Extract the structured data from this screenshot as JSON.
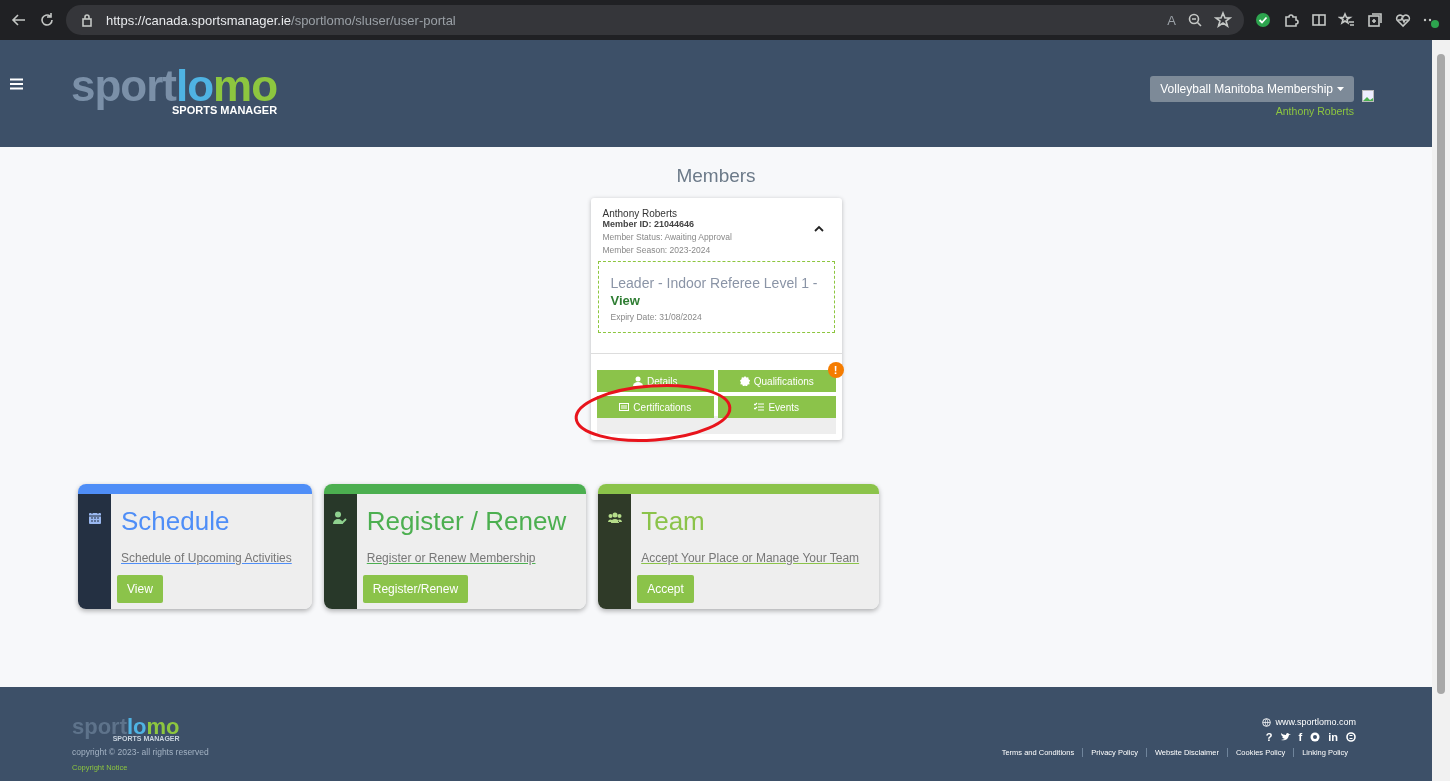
{
  "browser": {
    "url_host": "https://canada.sportsmanager.ie",
    "url_path": "/sportlomo/sluser/user-portal",
    "read_aloud": "A"
  },
  "header": {
    "logo": {
      "part1": "sport",
      "part2": "lomo",
      "tagline": "SPORTS MANAGER"
    },
    "org_dropdown": "Volleyball Manitoba Membership",
    "user_name": "Anthony Roberts"
  },
  "page_title": "Members",
  "member_card": {
    "name": "Anthony Roberts",
    "member_id": "Member ID: 21044646",
    "status": "Member Status: Awaiting Approval",
    "season": "Member Season: 2023-2024",
    "expanded": true,
    "qualification": {
      "title": "Leader - Indoor Referee Level 1  -",
      "link": "View",
      "expiry": "Expiry Date: 31/08/2024"
    },
    "buttons": [
      {
        "kind": "person",
        "label": "Details"
      },
      {
        "kind": "badge",
        "label": "Qualifications",
        "badge": "!"
      },
      {
        "kind": "card",
        "label": "Certifications"
      },
      {
        "kind": "list",
        "label": "Events"
      }
    ]
  },
  "annotation": {
    "kind": "ellipse",
    "color": "#e8141c"
  },
  "tiles": [
    {
      "kind": "calendar",
      "title": "Schedule",
      "link": "Schedule of Upcoming Activities",
      "button": "View",
      "color": "#4f8ef7"
    },
    {
      "kind": "person",
      "title": "Register / Renew",
      "link": "Register or Renew Membership",
      "button": "Register/Renew",
      "color": "#4caf50"
    },
    {
      "kind": "group",
      "title": "Team",
      "link": "Accept Your Place or Manage Your Team",
      "button": "Accept",
      "color": "#8bc34a"
    }
  ],
  "footer": {
    "logo": {
      "part1": "sport",
      "part2": "lomo",
      "tagline": "SPORTS MANAGER"
    },
    "copyright": "copyright © 2023- all rights reserved",
    "copyright_notice": "Copyright Notice",
    "website": "www.sportlomo.com",
    "social": [
      {
        "kind": "text",
        "label": "?"
      },
      {
        "kind": "twitter"
      },
      {
        "kind": "text",
        "label": "f"
      },
      {
        "kind": "circle"
      },
      {
        "kind": "text",
        "label": "in"
      },
      {
        "kind": "skype"
      }
    ],
    "links": [
      "Terms and Conditions",
      "Privacy Policy",
      "Website Disclaimer",
      "Cookies Policy",
      "Linking Policy"
    ]
  }
}
